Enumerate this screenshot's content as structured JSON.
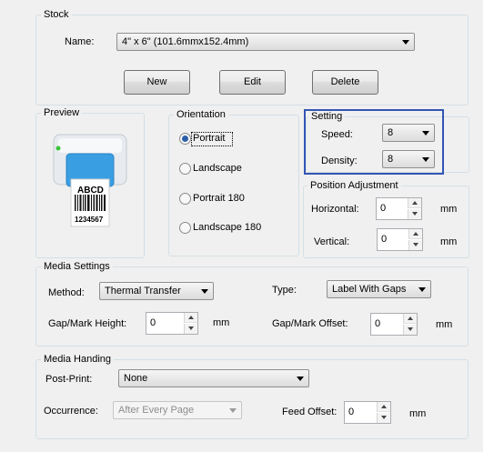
{
  "stock": {
    "title": "Stock",
    "name_label": "Name:",
    "name_value": "4\" x 6\" (101.6mmx152.4mm)",
    "new_label": "New",
    "edit_label": "Edit",
    "delete_label": "Delete"
  },
  "preview": {
    "title": "Preview",
    "label_text": "ABCD",
    "barcode_text": "1234567"
  },
  "orientation": {
    "title": "Orientation",
    "options": [
      "Portrait",
      "Landscape",
      "Portrait 180",
      "Landscape 180"
    ],
    "selected": "Portrait"
  },
  "setting": {
    "title": "Setting",
    "speed_label": "Speed:",
    "speed_value": "8",
    "density_label": "Density:",
    "density_value": "8",
    "highlight_color": "#3455b5"
  },
  "position": {
    "title": "Position Adjustment",
    "horizontal_label": "Horizontal:",
    "horizontal_value": "0",
    "horizontal_unit": "mm",
    "vertical_label": "Vertical:",
    "vertical_value": "0",
    "vertical_unit": "mm"
  },
  "media": {
    "title": "Media Settings",
    "method_label": "Method:",
    "method_value": "Thermal Transfer",
    "type_label": "Type:",
    "type_value": "Label With Gaps",
    "gap_height_label": "Gap/Mark Height:",
    "gap_height_value": "0",
    "gap_height_unit": "mm",
    "gap_offset_label": "Gap/Mark Offset:",
    "gap_offset_value": "0",
    "gap_offset_unit": "mm"
  },
  "handling": {
    "title": "Media Handing",
    "postprint_label": "Post-Print:",
    "postprint_value": "None",
    "occurrence_label": "Occurrence:",
    "occurrence_value": "After Every Page",
    "feed_offset_label": "Feed Offset:",
    "feed_offset_value": "0",
    "feed_offset_unit": "mm"
  }
}
